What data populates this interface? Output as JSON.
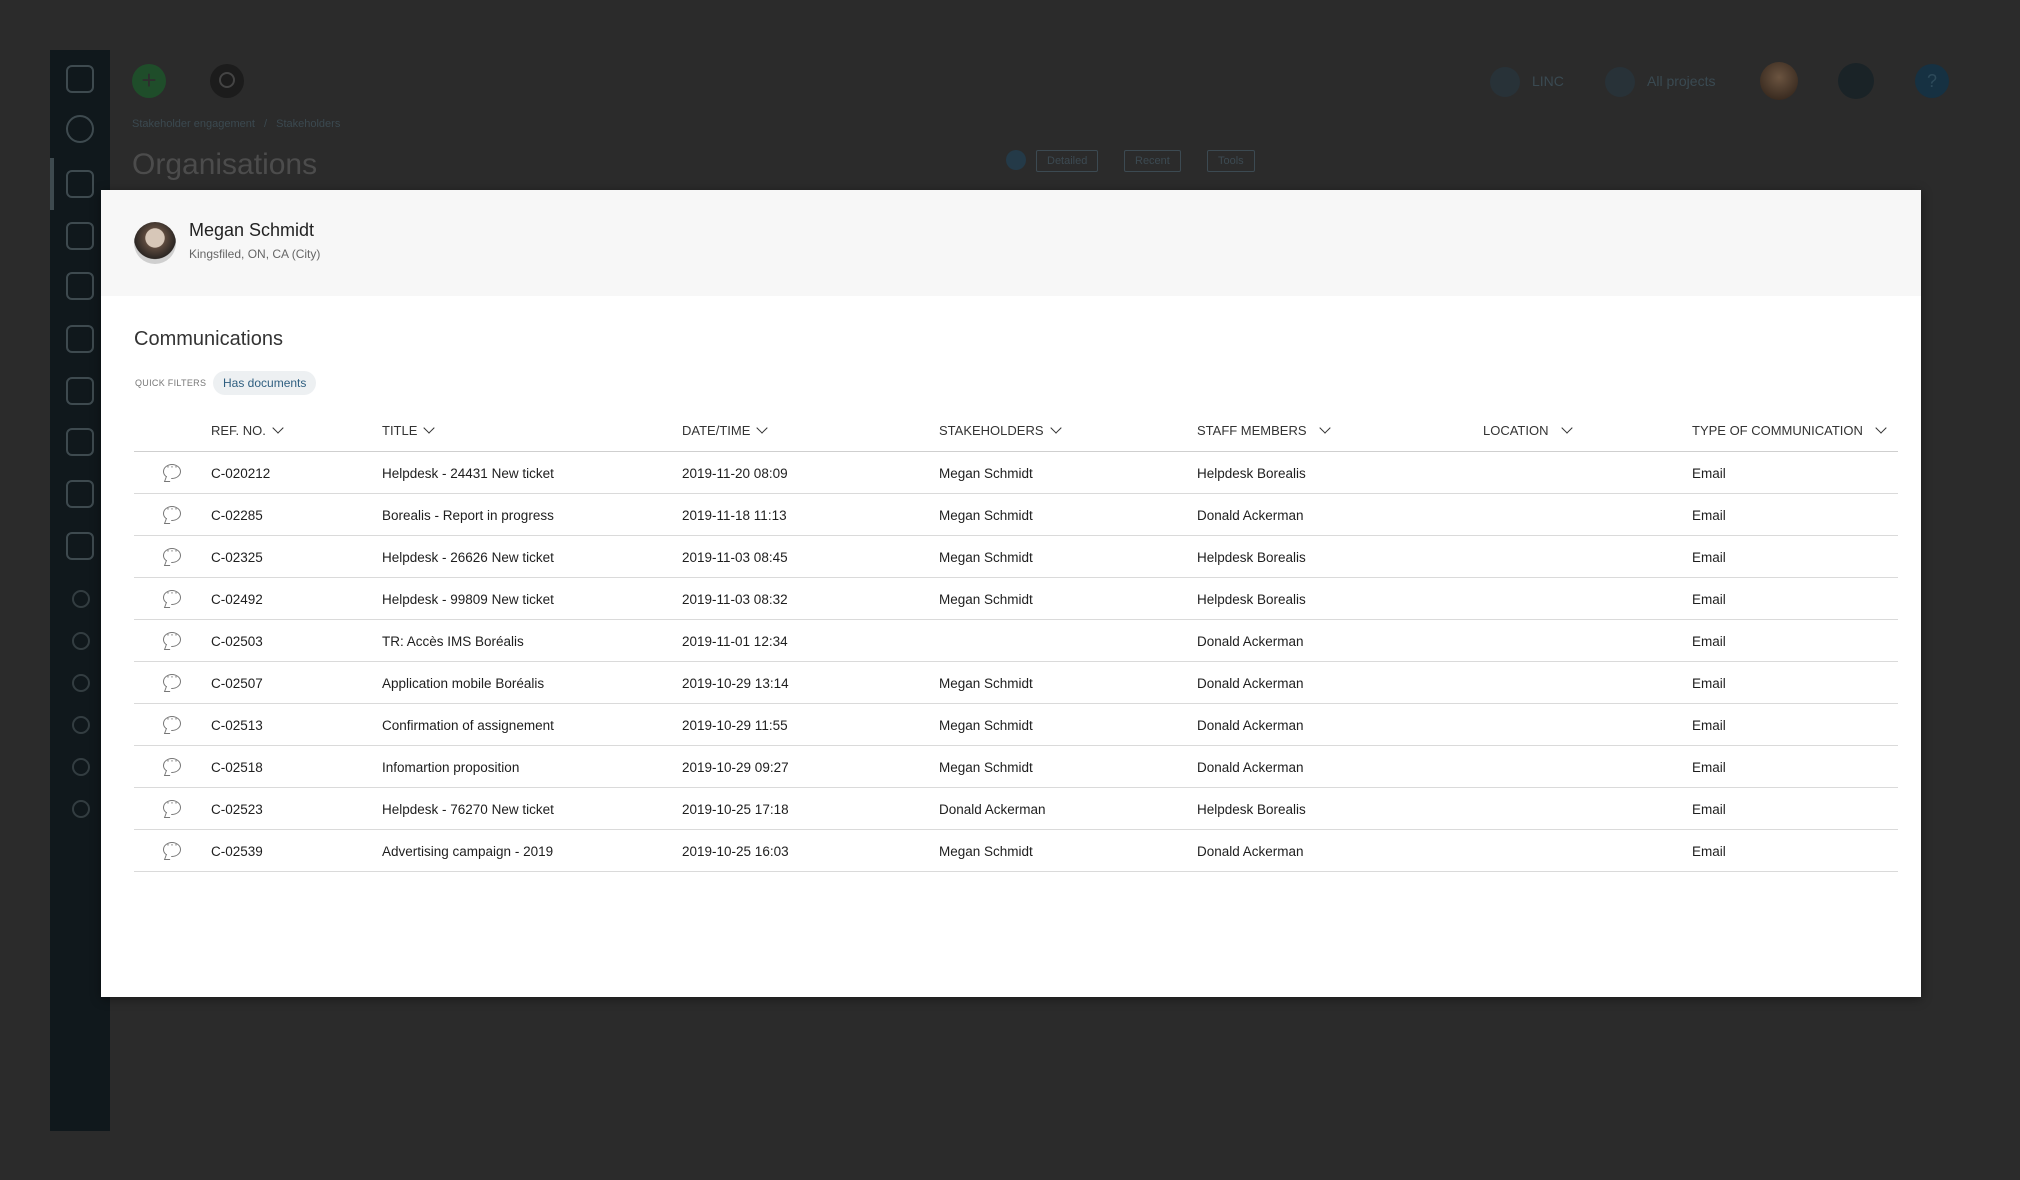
{
  "app": {
    "breadcrumb": [
      "Stakeholder engagement",
      "Stakeholders"
    ],
    "breadcrumb_sep": "/",
    "page_title": "Organisations",
    "top_links": {
      "linc": "LINC",
      "all_projects": "All projects"
    },
    "add_symbol": "+",
    "help_symbol": "?",
    "view_buttons": {
      "detailed": "Detailed",
      "recent": "Recent",
      "tools": "Tools"
    }
  },
  "profile": {
    "name": "Megan Schmidt",
    "location": "Kingsfiled, ON, CA (City)"
  },
  "communications": {
    "title": "Communications",
    "quick_filters_label": "QUICK FILTERS",
    "quick_filter_chip": "Has documents",
    "columns": {
      "ref": "REF. NO.",
      "title": "TITLE",
      "datetime": "DATE/TIME",
      "stakeholders": "STAKEHOLDERS",
      "staff": "STAFF MEMBERS",
      "location": "LOCATION",
      "type": "TYPE OF COMMUNICATION"
    },
    "rows": [
      {
        "ref": "C-020212",
        "title": "Helpdesk - 24431 New ticket",
        "datetime": "2019-11-20 08:09",
        "stakeholders": "Megan Schmidt",
        "staff": "Helpdesk Borealis",
        "location": "",
        "type": "Email"
      },
      {
        "ref": "C-02285",
        "title": "Borealis - Report in progress",
        "datetime": "2019-11-18 11:13",
        "stakeholders": "Megan Schmidt",
        "staff": "Donald Ackerman",
        "location": "",
        "type": "Email"
      },
      {
        "ref": "C-02325",
        "title": "Helpdesk - 26626 New ticket",
        "datetime": "2019-11-03 08:45",
        "stakeholders": "Megan Schmidt",
        "staff": "Helpdesk Borealis",
        "location": "",
        "type": "Email"
      },
      {
        "ref": "C-02492",
        "title": "Helpdesk - 99809 New ticket",
        "datetime": "2019-11-03 08:32",
        "stakeholders": "Megan Schmidt",
        "staff": "Helpdesk Borealis",
        "location": "",
        "type": "Email"
      },
      {
        "ref": "C-02503",
        "title": "TR: Accès IMS Boréalis",
        "datetime": "2019-11-01 12:34",
        "stakeholders": "",
        "staff": "Donald Ackerman",
        "location": "",
        "type": "Email"
      },
      {
        "ref": "C-02507",
        "title": "Application mobile Boréalis",
        "datetime": "2019-10-29 13:14",
        "stakeholders": "Megan Schmidt",
        "staff": "Donald Ackerman",
        "location": "",
        "type": "Email"
      },
      {
        "ref": "C-02513",
        "title": "Confirmation of assignement",
        "datetime": "2019-10-29 11:55",
        "stakeholders": "Megan Schmidt",
        "staff": "Donald Ackerman",
        "location": "",
        "type": "Email"
      },
      {
        "ref": "C-02518",
        "title": "Infomartion proposition",
        "datetime": "2019-10-29 09:27",
        "stakeholders": "Megan Schmidt",
        "staff": "Donald Ackerman",
        "location": "",
        "type": "Email"
      },
      {
        "ref": "C-02523",
        "title": "Helpdesk - 76270 New ticket",
        "datetime": "2019-10-25 17:18",
        "stakeholders": "Donald Ackerman",
        "staff": "Helpdesk Borealis",
        "location": "",
        "type": "Email"
      },
      {
        "ref": "C-02539",
        "title": "Advertising campaign - 2019",
        "datetime": "2019-10-25 16:03",
        "stakeholders": "Megan Schmidt",
        "staff": "Donald Ackerman",
        "location": "",
        "type": "Email"
      }
    ]
  }
}
